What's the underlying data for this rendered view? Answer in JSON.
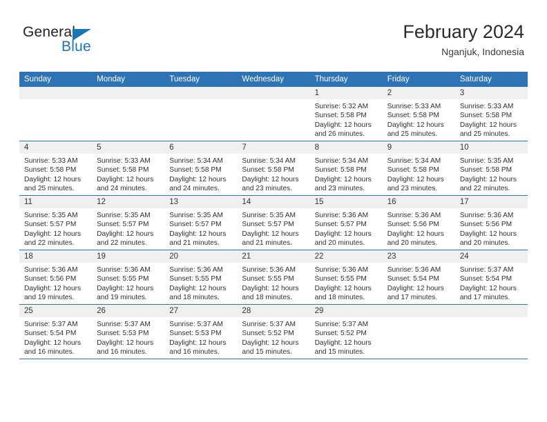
{
  "brand": {
    "name_part1": "General",
    "name_part2": "Blue",
    "triangle_color": "#1b75bb"
  },
  "header": {
    "title": "February 2024",
    "location": "Nganjuk, Indonesia",
    "accent_color": "#2e74b5",
    "band_color": "#f0f0f0"
  },
  "weekdays": [
    "Sunday",
    "Monday",
    "Tuesday",
    "Wednesday",
    "Thursday",
    "Friday",
    "Saturday"
  ],
  "labels": {
    "sunrise": "Sunrise:",
    "sunset": "Sunset:",
    "daylight": "Daylight:"
  },
  "weeks": [
    [
      {
        "day": "",
        "sunrise": "",
        "sunset": "",
        "daylight_line1": "",
        "daylight_line2": ""
      },
      {
        "day": "",
        "sunrise": "",
        "sunset": "",
        "daylight_line1": "",
        "daylight_line2": ""
      },
      {
        "day": "",
        "sunrise": "",
        "sunset": "",
        "daylight_line1": "",
        "daylight_line2": ""
      },
      {
        "day": "",
        "sunrise": "",
        "sunset": "",
        "daylight_line1": "",
        "daylight_line2": ""
      },
      {
        "day": "1",
        "sunrise": "Sunrise: 5:32 AM",
        "sunset": "Sunset: 5:58 PM",
        "daylight_line1": "Daylight: 12 hours",
        "daylight_line2": "and 26 minutes."
      },
      {
        "day": "2",
        "sunrise": "Sunrise: 5:33 AM",
        "sunset": "Sunset: 5:58 PM",
        "daylight_line1": "Daylight: 12 hours",
        "daylight_line2": "and 25 minutes."
      },
      {
        "day": "3",
        "sunrise": "Sunrise: 5:33 AM",
        "sunset": "Sunset: 5:58 PM",
        "daylight_line1": "Daylight: 12 hours",
        "daylight_line2": "and 25 minutes."
      }
    ],
    [
      {
        "day": "4",
        "sunrise": "Sunrise: 5:33 AM",
        "sunset": "Sunset: 5:58 PM",
        "daylight_line1": "Daylight: 12 hours",
        "daylight_line2": "and 25 minutes."
      },
      {
        "day": "5",
        "sunrise": "Sunrise: 5:33 AM",
        "sunset": "Sunset: 5:58 PM",
        "daylight_line1": "Daylight: 12 hours",
        "daylight_line2": "and 24 minutes."
      },
      {
        "day": "6",
        "sunrise": "Sunrise: 5:34 AM",
        "sunset": "Sunset: 5:58 PM",
        "daylight_line1": "Daylight: 12 hours",
        "daylight_line2": "and 24 minutes."
      },
      {
        "day": "7",
        "sunrise": "Sunrise: 5:34 AM",
        "sunset": "Sunset: 5:58 PM",
        "daylight_line1": "Daylight: 12 hours",
        "daylight_line2": "and 23 minutes."
      },
      {
        "day": "8",
        "sunrise": "Sunrise: 5:34 AM",
        "sunset": "Sunset: 5:58 PM",
        "daylight_line1": "Daylight: 12 hours",
        "daylight_line2": "and 23 minutes."
      },
      {
        "day": "9",
        "sunrise": "Sunrise: 5:34 AM",
        "sunset": "Sunset: 5:58 PM",
        "daylight_line1": "Daylight: 12 hours",
        "daylight_line2": "and 23 minutes."
      },
      {
        "day": "10",
        "sunrise": "Sunrise: 5:35 AM",
        "sunset": "Sunset: 5:58 PM",
        "daylight_line1": "Daylight: 12 hours",
        "daylight_line2": "and 22 minutes."
      }
    ],
    [
      {
        "day": "11",
        "sunrise": "Sunrise: 5:35 AM",
        "sunset": "Sunset: 5:57 PM",
        "daylight_line1": "Daylight: 12 hours",
        "daylight_line2": "and 22 minutes."
      },
      {
        "day": "12",
        "sunrise": "Sunrise: 5:35 AM",
        "sunset": "Sunset: 5:57 PM",
        "daylight_line1": "Daylight: 12 hours",
        "daylight_line2": "and 22 minutes."
      },
      {
        "day": "13",
        "sunrise": "Sunrise: 5:35 AM",
        "sunset": "Sunset: 5:57 PM",
        "daylight_line1": "Daylight: 12 hours",
        "daylight_line2": "and 21 minutes."
      },
      {
        "day": "14",
        "sunrise": "Sunrise: 5:35 AM",
        "sunset": "Sunset: 5:57 PM",
        "daylight_line1": "Daylight: 12 hours",
        "daylight_line2": "and 21 minutes."
      },
      {
        "day": "15",
        "sunrise": "Sunrise: 5:36 AM",
        "sunset": "Sunset: 5:57 PM",
        "daylight_line1": "Daylight: 12 hours",
        "daylight_line2": "and 20 minutes."
      },
      {
        "day": "16",
        "sunrise": "Sunrise: 5:36 AM",
        "sunset": "Sunset: 5:56 PM",
        "daylight_line1": "Daylight: 12 hours",
        "daylight_line2": "and 20 minutes."
      },
      {
        "day": "17",
        "sunrise": "Sunrise: 5:36 AM",
        "sunset": "Sunset: 5:56 PM",
        "daylight_line1": "Daylight: 12 hours",
        "daylight_line2": "and 20 minutes."
      }
    ],
    [
      {
        "day": "18",
        "sunrise": "Sunrise: 5:36 AM",
        "sunset": "Sunset: 5:56 PM",
        "daylight_line1": "Daylight: 12 hours",
        "daylight_line2": "and 19 minutes."
      },
      {
        "day": "19",
        "sunrise": "Sunrise: 5:36 AM",
        "sunset": "Sunset: 5:55 PM",
        "daylight_line1": "Daylight: 12 hours",
        "daylight_line2": "and 19 minutes."
      },
      {
        "day": "20",
        "sunrise": "Sunrise: 5:36 AM",
        "sunset": "Sunset: 5:55 PM",
        "daylight_line1": "Daylight: 12 hours",
        "daylight_line2": "and 18 minutes."
      },
      {
        "day": "21",
        "sunrise": "Sunrise: 5:36 AM",
        "sunset": "Sunset: 5:55 PM",
        "daylight_line1": "Daylight: 12 hours",
        "daylight_line2": "and 18 minutes."
      },
      {
        "day": "22",
        "sunrise": "Sunrise: 5:36 AM",
        "sunset": "Sunset: 5:55 PM",
        "daylight_line1": "Daylight: 12 hours",
        "daylight_line2": "and 18 minutes."
      },
      {
        "day": "23",
        "sunrise": "Sunrise: 5:36 AM",
        "sunset": "Sunset: 5:54 PM",
        "daylight_line1": "Daylight: 12 hours",
        "daylight_line2": "and 17 minutes."
      },
      {
        "day": "24",
        "sunrise": "Sunrise: 5:37 AM",
        "sunset": "Sunset: 5:54 PM",
        "daylight_line1": "Daylight: 12 hours",
        "daylight_line2": "and 17 minutes."
      }
    ],
    [
      {
        "day": "25",
        "sunrise": "Sunrise: 5:37 AM",
        "sunset": "Sunset: 5:54 PM",
        "daylight_line1": "Daylight: 12 hours",
        "daylight_line2": "and 16 minutes."
      },
      {
        "day": "26",
        "sunrise": "Sunrise: 5:37 AM",
        "sunset": "Sunset: 5:53 PM",
        "daylight_line1": "Daylight: 12 hours",
        "daylight_line2": "and 16 minutes."
      },
      {
        "day": "27",
        "sunrise": "Sunrise: 5:37 AM",
        "sunset": "Sunset: 5:53 PM",
        "daylight_line1": "Daylight: 12 hours",
        "daylight_line2": "and 16 minutes."
      },
      {
        "day": "28",
        "sunrise": "Sunrise: 5:37 AM",
        "sunset": "Sunset: 5:52 PM",
        "daylight_line1": "Daylight: 12 hours",
        "daylight_line2": "and 15 minutes."
      },
      {
        "day": "29",
        "sunrise": "Sunrise: 5:37 AM",
        "sunset": "Sunset: 5:52 PM",
        "daylight_line1": "Daylight: 12 hours",
        "daylight_line2": "and 15 minutes."
      },
      {
        "day": "",
        "sunrise": "",
        "sunset": "",
        "daylight_line1": "",
        "daylight_line2": ""
      },
      {
        "day": "",
        "sunrise": "",
        "sunset": "",
        "daylight_line1": "",
        "daylight_line2": ""
      }
    ]
  ]
}
